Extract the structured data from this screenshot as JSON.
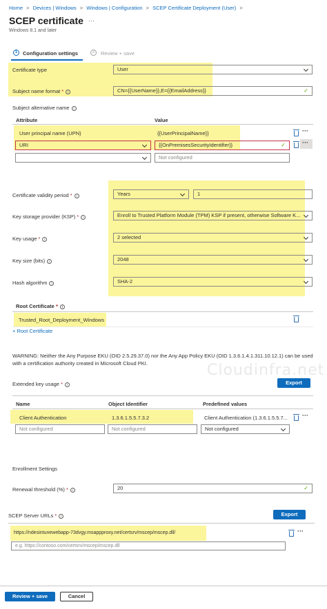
{
  "breadcrumb": [
    "Home",
    "Devices | Windows",
    "Windows | Configuration",
    "SCEP Certificate Deployment (User)"
  ],
  "page": {
    "title": "SCEP certificate",
    "subtitle": "Windows 8.1 and later",
    "more": "···"
  },
  "wizard": {
    "step1_num": "1",
    "step1_label": "Configuration settings",
    "step2_num": "2",
    "step2_label": "Review + save"
  },
  "certificate_type": {
    "label": "Certificate type",
    "value": "User"
  },
  "subject_name": {
    "label": "Subject name format",
    "value": "CN={{UserName}},E={{EmailAddress}}"
  },
  "san": {
    "label": "Subject alternative name",
    "col_attribute": "Attribute",
    "col_value": "Value",
    "rows": [
      {
        "attribute": "User principal name (UPN)",
        "value": "{{UserPrincipalName}}"
      },
      {
        "attribute": "URI",
        "value": "{{OnPremisesSecurityIdentifier}}"
      }
    ],
    "new_value_placeholder": "Not configured"
  },
  "validity": {
    "label": "Certificate validity period",
    "unit": "Years",
    "value": "1"
  },
  "ksp": {
    "label": "Key storage provider (KSP)",
    "value": "Enroll to Trusted Platform Module (TPM) KSP if present, otherwise Software K..."
  },
  "key_usage": {
    "label": "Key usage",
    "value": "2 selected"
  },
  "key_size": {
    "label": "Key size (bits)",
    "value": "2048"
  },
  "hash": {
    "label": "Hash algorithm",
    "value": "SHA-2"
  },
  "root_cert": {
    "label": "Root Certificate",
    "value": "Trusted_Root_Deployment_Windows",
    "add_link": "+ Root Certificate"
  },
  "warning": "WARNING: Neither the Any Purpose EKU (OID 2.5.29.37.0) nor the Any App Policy EKU (OID 1.3.6.1.4.1.311.10.12.1) can be used with a certification authority created in Microsoft Cloud PKI.",
  "watermark": "Cloudinfra.net",
  "eku": {
    "label": "Extended key usage",
    "export": "Export",
    "col_name": "Name",
    "col_oid": "Object Identifier",
    "col_predefined": "Predefined values",
    "row": {
      "name": "Client Authentication",
      "oid": "1.3.6.1.5.5.7.3.2",
      "predefined": "Client Authentication (1.3.6.1.5.5.7..."
    },
    "placeholder_name": "Not configured",
    "placeholder_oid": "Not configured",
    "placeholder_predefined": "Not configured"
  },
  "enrollment": {
    "heading": "Enrollment Settings",
    "renewal_label": "Renewal threshold (%)",
    "renewal_value": "20"
  },
  "scep": {
    "label": "SCEP Server URLs",
    "export": "Export",
    "url": "https://ndesintunewebapp-73dvgy.msappproxy.net/certsrv/mscep/mscep.dll/",
    "placeholder": "e.g. https://contoso.com/certsrv/mscep/mscep.dll"
  },
  "footer": {
    "review": "Review + save",
    "cancel": "Cancel"
  },
  "colors": {
    "accent": "#0f6cbd",
    "highlight": "#fbf59b",
    "check": "#57a300"
  }
}
